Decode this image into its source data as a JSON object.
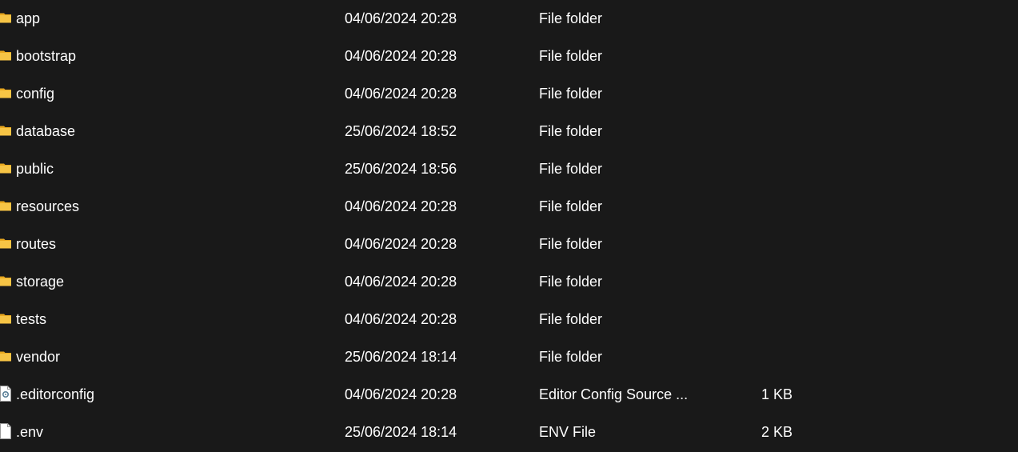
{
  "files": [
    {
      "name": "app",
      "date": "04/06/2024 20:28",
      "type": "File folder",
      "size": "",
      "icon": "folder-icon"
    },
    {
      "name": "bootstrap",
      "date": "04/06/2024 20:28",
      "type": "File folder",
      "size": "",
      "icon": "folder-icon"
    },
    {
      "name": "config",
      "date": "04/06/2024 20:28",
      "type": "File folder",
      "size": "",
      "icon": "folder-icon"
    },
    {
      "name": "database",
      "date": "25/06/2024 18:52",
      "type": "File folder",
      "size": "",
      "icon": "folder-icon"
    },
    {
      "name": "public",
      "date": "25/06/2024 18:56",
      "type": "File folder",
      "size": "",
      "icon": "folder-icon"
    },
    {
      "name": "resources",
      "date": "04/06/2024 20:28",
      "type": "File folder",
      "size": "",
      "icon": "folder-icon"
    },
    {
      "name": "routes",
      "date": "04/06/2024 20:28",
      "type": "File folder",
      "size": "",
      "icon": "folder-icon"
    },
    {
      "name": "storage",
      "date": "04/06/2024 20:28",
      "type": "File folder",
      "size": "",
      "icon": "folder-icon"
    },
    {
      "name": "tests",
      "date": "04/06/2024 20:28",
      "type": "File folder",
      "size": "",
      "icon": "folder-icon"
    },
    {
      "name": "vendor",
      "date": "25/06/2024 18:14",
      "type": "File folder",
      "size": "",
      "icon": "folder-icon"
    },
    {
      "name": ".editorconfig",
      "date": "04/06/2024 20:28",
      "type": "Editor Config Source ...",
      "size": "1 KB",
      "icon": "settings-file-icon"
    },
    {
      "name": ".env",
      "date": "25/06/2024 18:14",
      "type": "ENV File",
      "size": "2 KB",
      "icon": "file-icon"
    }
  ],
  "colors": {
    "background": "#191919",
    "text": "#ffffff",
    "folder": "#f6c445"
  }
}
